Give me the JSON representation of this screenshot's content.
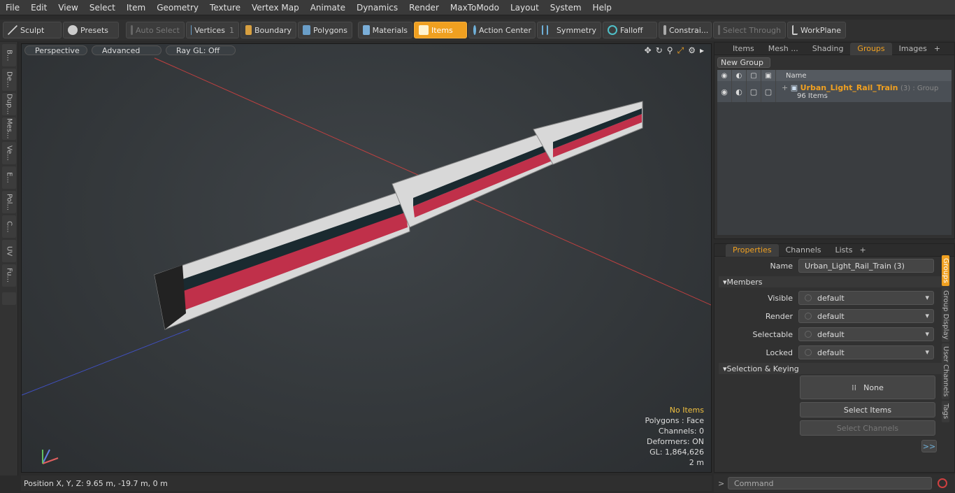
{
  "menu": [
    "File",
    "Edit",
    "View",
    "Select",
    "Item",
    "Geometry",
    "Texture",
    "Vertex Map",
    "Animate",
    "Dynamics",
    "Render",
    "MaxToModo",
    "Layout",
    "System",
    "Help"
  ],
  "toolbar": {
    "sculpt": "Sculpt",
    "presets": "Presets",
    "auto_select": "Auto Select",
    "vertices": "Vertices",
    "vertices_count": "1",
    "boundary": "Boundary",
    "polygons": "Polygons",
    "materials": "Materials",
    "items": "Items",
    "action_center": "Action Center",
    "symmetry": "Symmetry",
    "falloff": "Falloff",
    "constraints": "Constrai...",
    "select_through": "Select Through",
    "workplane": "WorkPlane"
  },
  "left_tabs": [
    "B...",
    "De...",
    "Dup...",
    "Mes...",
    "Ve...",
    "E...",
    "Pol...",
    "C...",
    "UV",
    "Fu..."
  ],
  "viewport": {
    "view": "Perspective",
    "shading": "Advanced",
    "raygl": "Ray GL: Off",
    "info": {
      "selection": "No Items",
      "polygons": "Polygons : Face",
      "channels": "Channels: 0",
      "deformers": "Deformers: ON",
      "gl": "GL: 1,864,626",
      "scale": "2 m"
    }
  },
  "status": {
    "position": "Position X, Y, Z:   9.65 m, -19.7 m, 0 m"
  },
  "groups_panel": {
    "tabs": [
      "Items",
      "Mesh ...",
      "Shading",
      "Groups",
      "Images"
    ],
    "new_group": "New Group",
    "name_header": "Name",
    "group_name": "Urban_Light_Rail_Train",
    "group_suffix": "(3) : Group",
    "group_count": "96 Items"
  },
  "properties_panel": {
    "tabs": [
      "Properties",
      "Channels",
      "Lists"
    ],
    "name_label": "Name",
    "name_value": "Urban_Light_Rail_Train (3)",
    "members": "Members",
    "visible_label": "Visible",
    "visible_value": "default",
    "render_label": "Render",
    "render_value": "default",
    "selectable_label": "Selectable",
    "selectable_value": "default",
    "locked_label": "Locked",
    "locked_value": "default",
    "selection_keying": "Selection & Keying",
    "none": "None",
    "select_items": "Select Items",
    "select_channels": "Select Channels",
    "more": ">>",
    "side_tabs": [
      "Groups",
      "Group Display",
      "User Channels",
      "Tags"
    ]
  },
  "command": {
    "placeholder": "Command"
  }
}
